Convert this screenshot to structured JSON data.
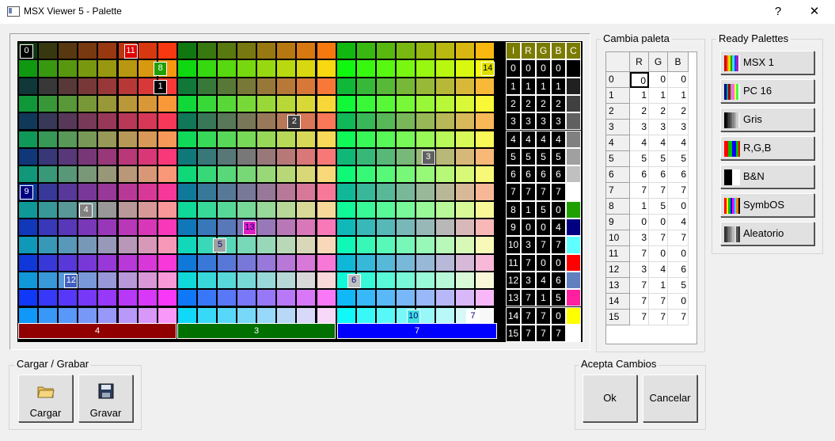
{
  "window": {
    "title": "MSX Viewer 5 - Palette",
    "help_label": "?",
    "close_label": "✕"
  },
  "palette_grid": {
    "description_note": "24 columns x 16 rows of color swatches; 3 blocks of 8 columns",
    "markers": [
      {
        "label": "0",
        "col": 0,
        "row": 0,
        "fg": "#ffffff",
        "bg": "#000000"
      },
      {
        "label": "11",
        "col": 7,
        "row": 0,
        "fg": "#ffffff",
        "bg": "#e00000"
      },
      {
        "label": "8",
        "col": 9,
        "row": 1,
        "fg": "#ffffff",
        "bg": "#20a000"
      },
      {
        "label": "14",
        "col": 31,
        "row": 1,
        "fg": "#000000",
        "bg": "#e0e000"
      },
      {
        "label": "1",
        "col": 9,
        "row": 2,
        "fg": "#ffffff",
        "bg": "#000000"
      },
      {
        "label": "2",
        "col": 18,
        "row": 4,
        "fg": "#ffffff",
        "bg": "#404040"
      },
      {
        "label": "3",
        "col": 27,
        "row": 6,
        "fg": "#ffffff",
        "bg": "#606060"
      },
      {
        "label": "9",
        "col": 0,
        "row": 8,
        "fg": "#ffffff",
        "bg": "#000080"
      },
      {
        "label": "4",
        "col": 4,
        "row": 9,
        "fg": "#ffffff",
        "bg": "#808080"
      },
      {
        "label": "13",
        "col": 15,
        "row": 10,
        "fg": "#000080",
        "bg": "#e020c0"
      },
      {
        "label": "5",
        "col": 13,
        "row": 11,
        "fg": "#000080",
        "bg": "#a0a0a0"
      },
      {
        "label": "12",
        "col": 3,
        "row": 13,
        "fg": "#ffffff",
        "bg": "#4060c0"
      },
      {
        "label": "6",
        "col": 22,
        "row": 13,
        "fg": "#000080",
        "bg": "#c0c0c0"
      },
      {
        "label": "10",
        "col": 26,
        "row": 15,
        "fg": "#000080",
        "bg": "#40e0e0"
      },
      {
        "label": "7",
        "col": 30,
        "row": 15,
        "fg": "#000080",
        "bg": "#ffffff"
      }
    ],
    "bars": [
      {
        "label": "4",
        "color": "#900000"
      },
      {
        "label": "3",
        "color": "#007000"
      },
      {
        "label": "7",
        "color": "#0000ff"
      }
    ]
  },
  "palette_table": {
    "headers": [
      "I",
      "R",
      "G",
      "B",
      "C"
    ],
    "rows": [
      {
        "i": "0",
        "r": "0",
        "g": "0",
        "b": "0",
        "c": "#000000"
      },
      {
        "i": "1",
        "r": "1",
        "g": "1",
        "b": "1",
        "c": "#202020"
      },
      {
        "i": "2",
        "r": "2",
        "g": "2",
        "b": "2",
        "c": "#404040"
      },
      {
        "i": "3",
        "r": "3",
        "g": "3",
        "b": "3",
        "c": "#606060"
      },
      {
        "i": "4",
        "r": "4",
        "g": "4",
        "b": "4",
        "c": "#808080"
      },
      {
        "i": "5",
        "r": "5",
        "g": "5",
        "b": "5",
        "c": "#a0a0a0"
      },
      {
        "i": "6",
        "r": "6",
        "g": "6",
        "b": "6",
        "c": "#c0c0c0"
      },
      {
        "i": "7",
        "r": "7",
        "g": "7",
        "b": "7",
        "c": "#ffffff"
      },
      {
        "i": "8",
        "r": "1",
        "g": "5",
        "b": "0",
        "c": "#20a000"
      },
      {
        "i": "9",
        "r": "0",
        "g": "0",
        "b": "4",
        "c": "#000080"
      },
      {
        "i": "10",
        "r": "3",
        "g": "7",
        "b": "7",
        "c": "#60ffff"
      },
      {
        "i": "11",
        "r": "7",
        "g": "0",
        "b": "0",
        "c": "#ff0000"
      },
      {
        "i": "12",
        "r": "3",
        "g": "4",
        "b": "6",
        "c": "#6080c0"
      },
      {
        "i": "13",
        "r": "7",
        "g": "1",
        "b": "5",
        "c": "#ff20a0"
      },
      {
        "i": "14",
        "r": "7",
        "g": "7",
        "b": "0",
        "c": "#ffff00"
      },
      {
        "i": "15",
        "r": "7",
        "g": "7",
        "b": "7",
        "c": "#ffffff"
      }
    ]
  },
  "cambia_paleta": {
    "title": "Cambia paleta",
    "headers": [
      "R",
      "G",
      "B"
    ],
    "rows": [
      {
        "idx": "0",
        "r": "0",
        "g": "0",
        "b": "0"
      },
      {
        "idx": "1",
        "r": "1",
        "g": "1",
        "b": "1"
      },
      {
        "idx": "2",
        "r": "2",
        "g": "2",
        "b": "2"
      },
      {
        "idx": "3",
        "r": "3",
        "g": "3",
        "b": "3"
      },
      {
        "idx": "4",
        "r": "4",
        "g": "4",
        "b": "4"
      },
      {
        "idx": "5",
        "r": "5",
        "g": "5",
        "b": "5"
      },
      {
        "idx": "6",
        "r": "6",
        "g": "6",
        "b": "6"
      },
      {
        "idx": "7",
        "r": "7",
        "g": "7",
        "b": "7"
      },
      {
        "idx": "8",
        "r": "1",
        "g": "5",
        "b": "0"
      },
      {
        "idx": "9",
        "r": "0",
        "g": "0",
        "b": "4"
      },
      {
        "idx": "10",
        "r": "3",
        "g": "7",
        "b": "7"
      },
      {
        "idx": "11",
        "r": "7",
        "g": "0",
        "b": "0"
      },
      {
        "idx": "12",
        "r": "3",
        "g": "4",
        "b": "6"
      },
      {
        "idx": "13",
        "r": "7",
        "g": "1",
        "b": "5"
      },
      {
        "idx": "14",
        "r": "7",
        "g": "7",
        "b": "0"
      },
      {
        "idx": "15",
        "r": "7",
        "g": "7",
        "b": "7"
      }
    ]
  },
  "ready_palettes": {
    "title": "Ready Palettes",
    "buttons": [
      {
        "label": "MSX 1",
        "icon": "msx1-palette-icon"
      },
      {
        "label": "PC 16",
        "icon": "pc16-palette-icon"
      },
      {
        "label": "Gris",
        "icon": "gray-palette-icon"
      },
      {
        "label": "R,G,B",
        "icon": "rgb-palette-icon"
      },
      {
        "label": "B&N",
        "icon": "bw-palette-icon"
      },
      {
        "label": "SymbOS",
        "icon": "symbos-palette-icon"
      },
      {
        "label": "Aleatorio",
        "icon": "dice-icon"
      }
    ]
  },
  "load_save": {
    "title": "Cargar / Grabar",
    "load_label": "Cargar",
    "save_label": "Gravar"
  },
  "accept": {
    "title": "Acepta Cambios",
    "ok_label": "Ok",
    "cancel_label": "Cancelar"
  }
}
